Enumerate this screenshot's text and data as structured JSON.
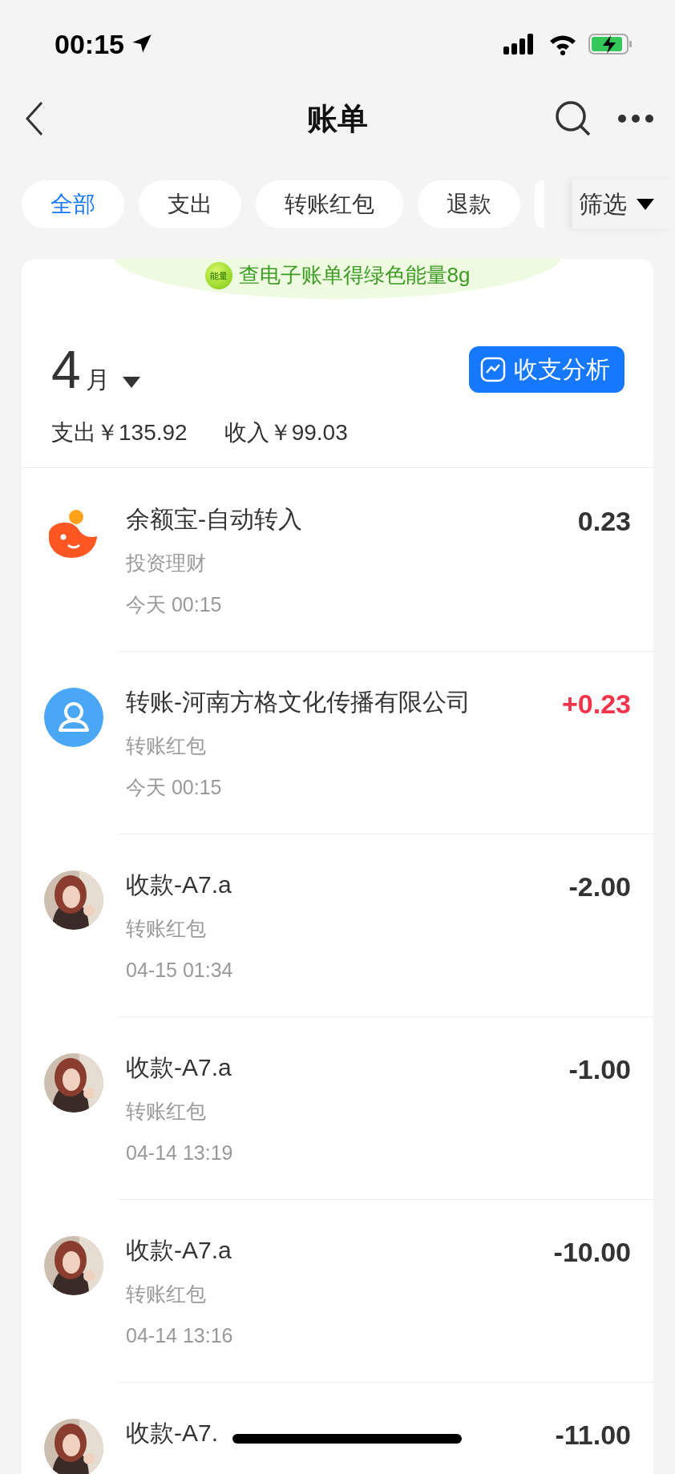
{
  "status_bar": {
    "time": "00:15"
  },
  "nav": {
    "title": "账单"
  },
  "filters": [
    {
      "label": "全部",
      "selected": true
    },
    {
      "label": "支出",
      "selected": false
    },
    {
      "label": "转账红包",
      "selected": false
    },
    {
      "label": "退款",
      "selected": false
    }
  ],
  "filter_button": {
    "label": "筛选"
  },
  "banner": {
    "badge": "能量",
    "text": "查电子账单得绿色能量8g"
  },
  "month": {
    "number": "4",
    "unit": "月"
  },
  "analysis_button": {
    "label": "收支分析"
  },
  "summary": {
    "expense": "支出￥135.92",
    "income": "收入￥99.03"
  },
  "transactions": [
    {
      "kind": "fund",
      "title": "余额宝-自动转入",
      "category": "投资理财",
      "time": "今天 00:15",
      "amount": "0.23",
      "color": "#333333"
    },
    {
      "kind": "contact",
      "title": "转账-河南方格文化传播有限公司",
      "category": "转账红包",
      "time": "今天 00:15",
      "amount": "+0.23",
      "color": "#f5334b"
    },
    {
      "title": "收款-A7.a",
      "category": "转账红包",
      "time": "04-15 01:34",
      "amount": "-2.00",
      "color": "#333333"
    },
    {
      "title": "收款-A7.a",
      "category": "转账红包",
      "time": "04-14 13:19",
      "amount": "-1.00",
      "color": "#333333"
    },
    {
      "title": "收款-A7.a",
      "category": "转账红包",
      "time": "04-14 13:16",
      "amount": "-10.00",
      "color": "#333333"
    },
    {
      "title": "收款-A7.",
      "amount": "-11.00",
      "color": "#333333"
    }
  ]
}
